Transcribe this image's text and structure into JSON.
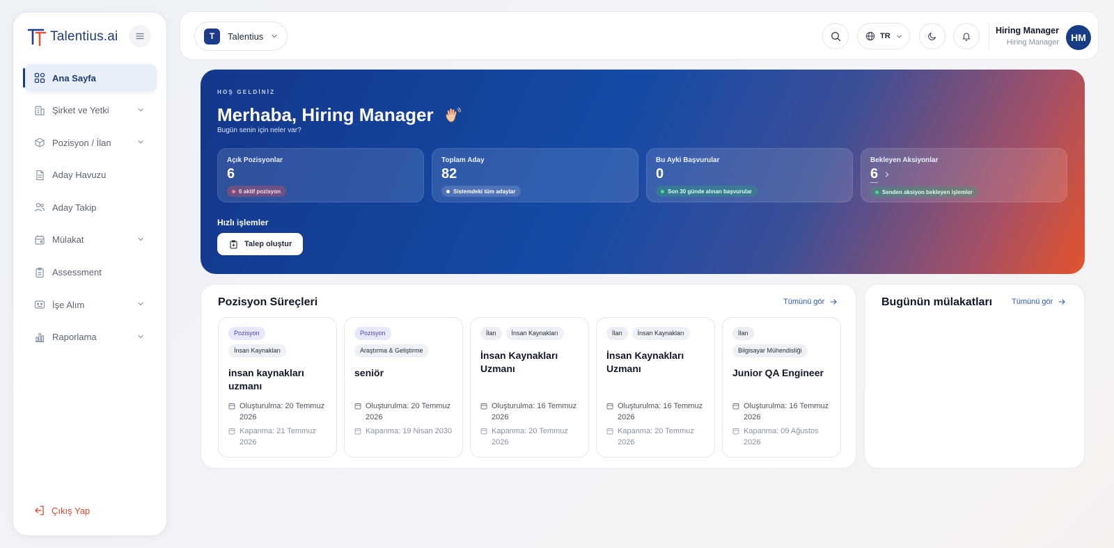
{
  "brand": {
    "name": "Talentius",
    "suffix": ".ai"
  },
  "sidebar": {
    "items": [
      {
        "label": "Ana Sayfa",
        "icon": "grid-icon",
        "active": true,
        "has_children": false
      },
      {
        "label": "Şirket ve Yetki",
        "icon": "building-icon",
        "active": false,
        "has_children": true
      },
      {
        "label": "Pozisyon / İlan",
        "icon": "box-icon",
        "active": false,
        "has_children": true
      },
      {
        "label": "Aday Havuzu",
        "icon": "file-icon",
        "active": false,
        "has_children": false
      },
      {
        "label": "Aday Takip",
        "icon": "users-icon",
        "active": false,
        "has_children": false
      },
      {
        "label": "Mülakat",
        "icon": "calendar-icon",
        "active": false,
        "has_children": true
      },
      {
        "label": "Assessment",
        "icon": "clipboard-icon",
        "active": false,
        "has_children": false
      },
      {
        "label": "İşe Alım",
        "icon": "id-card-icon",
        "active": false,
        "has_children": true
      },
      {
        "label": "Raporlama",
        "icon": "bar-chart-icon",
        "active": false,
        "has_children": true
      }
    ],
    "logout_label": "Çıkış Yap"
  },
  "header": {
    "company_initial": "T",
    "company_name": "Talentius",
    "language_code": "TR",
    "user_name": "Hiring Manager",
    "user_role": "Hiring Manager",
    "user_initials": "HM"
  },
  "hero": {
    "kicker": "HOŞ GELDİNİZ",
    "title": "Merhaba, Hiring Manager",
    "subtitle": "Bugün senin için neler var?",
    "stats": [
      {
        "label": "Açık Pozisyonlar",
        "value": "6",
        "note": "6 aktif pozisyon",
        "tone": "red"
      },
      {
        "label": "Toplam Aday",
        "value": "82",
        "note": "Sistemdeki tüm adaylar",
        "tone": "blue"
      },
      {
        "label": "Bu Ayki Başvurular",
        "value": "0",
        "note": "Son 30 günde alınan başvurular",
        "tone": "green"
      },
      {
        "label": "Bekleyen Aksiyonlar",
        "value": "6",
        "note": "Senden aksiyon bekleyen işlemler",
        "tone": "green"
      }
    ],
    "quick_title": "Hızlı işlemler",
    "quick_button": "Talep oluştur"
  },
  "positions": {
    "title": "Pozisyon Süreçleri",
    "see_all": "Tümünü gör",
    "cards": [
      {
        "type": "Pozisyon",
        "dept": "İnsan Kaynakları",
        "title": "insan kaynakları uzmanı",
        "created": "Oluşturulma: 20 Temmuz 2026",
        "closing": "Kapanma: 21 Temmuz 2026"
      },
      {
        "type": "Pozisyon",
        "dept": "Araştırma & Geliştirme",
        "title": "seniör",
        "created": "Oluşturulma: 20 Temmuz 2026",
        "closing": "Kapanma: 19 Nisan 2030"
      },
      {
        "type": "İlan",
        "dept": "İnsan Kaynakları",
        "title": "İnsan Kaynakları Uzmanı",
        "created": "Oluşturulma: 16 Temmuz 2026",
        "closing": "Kapanma: 20 Temmuz 2026"
      },
      {
        "type": "İlan",
        "dept": "İnsan Kaynakları",
        "title": "İnsan Kaynakları Uzmanı",
        "created": "Oluşturulma: 16 Temmuz 2026",
        "closing": "Kapanma: 20 Temmuz 2026"
      },
      {
        "type": "İlan",
        "dept": "Bilgisayar Mühendisliği",
        "title": "Junior QA Engineer",
        "created": "Oluşturulma: 16 Temmuz 2026",
        "closing": "Kapanma: 09 Ağustos 2026"
      }
    ]
  },
  "interviews": {
    "title": "Bugünün mülakatları",
    "see_all": "Tümünü gör"
  },
  "colors": {
    "brand_navy": "#1e3a8a",
    "accent_orange": "#e4532b",
    "link_blue": "#2b5bbf"
  }
}
